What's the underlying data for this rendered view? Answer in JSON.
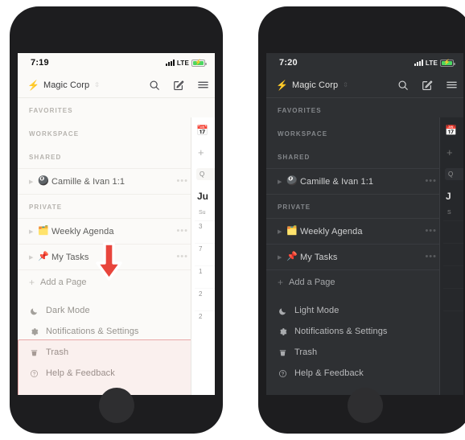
{
  "annotation": {
    "arrow_icon": "down-arrow",
    "arrow_color": "#e8453c",
    "highlight_color": "#e9a7a7"
  },
  "phones": [
    {
      "id": "light-phone",
      "theme": "light",
      "status": {
        "time": "7:19",
        "network": "LTE",
        "battery_icon": "battery-charging",
        "signal_icon": "signal-bars"
      },
      "header": {
        "workspace_emoji": "⚡",
        "workspace_name": "Magic Corp",
        "switcher_icon": "chevron-updown-icon",
        "search_icon": "search-icon",
        "compose_icon": "compose-icon",
        "menu_icon": "hamburger-menu-icon"
      },
      "sections": [
        {
          "label": "FAVORITES",
          "items": []
        },
        {
          "label": "WORKSPACE",
          "items": []
        },
        {
          "label": "SHARED",
          "items": [
            {
              "emoji": "🎱",
              "label": "Camille & Ivan 1:1",
              "expand": "▶",
              "dots": "•••",
              "plus": "+"
            }
          ]
        },
        {
          "label": "PRIVATE",
          "items": [
            {
              "emoji": "🗂️",
              "label": "Weekly Agenda",
              "expand": "▶",
              "dots": "•••",
              "plus": "+"
            },
            {
              "emoji": "📌",
              "label": "My Tasks",
              "expand": "▶",
              "dots": "•••",
              "plus": "+"
            }
          ]
        }
      ],
      "add_page": {
        "plus": "+",
        "label": "Add a Page"
      },
      "menu": [
        {
          "icon": "moon-icon",
          "glyph": "🌙",
          "label": "Dark Mode"
        },
        {
          "icon": "gear-icon",
          "glyph": "✿",
          "label": "Notifications & Settings"
        },
        {
          "icon": "trash-icon",
          "glyph": "🗑",
          "label": "Trash"
        },
        {
          "icon": "help-circle-icon",
          "glyph": "?",
          "label": "Help & Feedback"
        }
      ],
      "peek": {
        "calendar_emoji": "📅",
        "plus": "+",
        "search_placeholder": "Q",
        "month": "Ju",
        "dow": "Su",
        "days": [
          "3",
          "7",
          "1",
          "2",
          "2"
        ]
      }
    },
    {
      "id": "dark-phone",
      "theme": "dark",
      "status": {
        "time": "7:20",
        "network": "LTE",
        "battery_icon": "battery-charging",
        "signal_icon": "signal-bars"
      },
      "header": {
        "workspace_emoji": "⚡",
        "workspace_name": "Magic Corp",
        "switcher_icon": "chevron-updown-icon",
        "search_icon": "search-icon",
        "compose_icon": "compose-icon",
        "menu_icon": "hamburger-menu-icon"
      },
      "sections": [
        {
          "label": "FAVORITES",
          "items": []
        },
        {
          "label": "WORKSPACE",
          "items": []
        },
        {
          "label": "SHARED",
          "items": [
            {
              "emoji": "🎱",
              "label": "Camille & Ivan 1:1",
              "expand": "▶",
              "dots": "•••",
              "plus": "+"
            }
          ]
        },
        {
          "label": "PRIVATE",
          "items": [
            {
              "emoji": "🗂️",
              "label": "Weekly Agenda",
              "expand": "▶",
              "dots": "•••",
              "plus": "+"
            },
            {
              "emoji": "📌",
              "label": "My Tasks",
              "expand": "▶",
              "dots": "•••",
              "plus": "+"
            }
          ]
        }
      ],
      "add_page": {
        "plus": "+",
        "label": "Add a Page"
      },
      "menu": [
        {
          "icon": "moon-icon",
          "glyph": "🌙",
          "label": "Light Mode"
        },
        {
          "icon": "gear-icon",
          "glyph": "✿",
          "label": "Notifications & Settings"
        },
        {
          "icon": "trash-icon",
          "glyph": "🗑",
          "label": "Trash"
        },
        {
          "icon": "help-circle-icon",
          "glyph": "?",
          "label": "Help & Feedback"
        }
      ],
      "peek": {
        "calendar_emoji": "📅",
        "plus": "+",
        "search_placeholder": "Q",
        "month": "J",
        "dow": "S",
        "days": [
          "",
          "",
          "",
          "",
          ""
        ]
      }
    }
  ]
}
